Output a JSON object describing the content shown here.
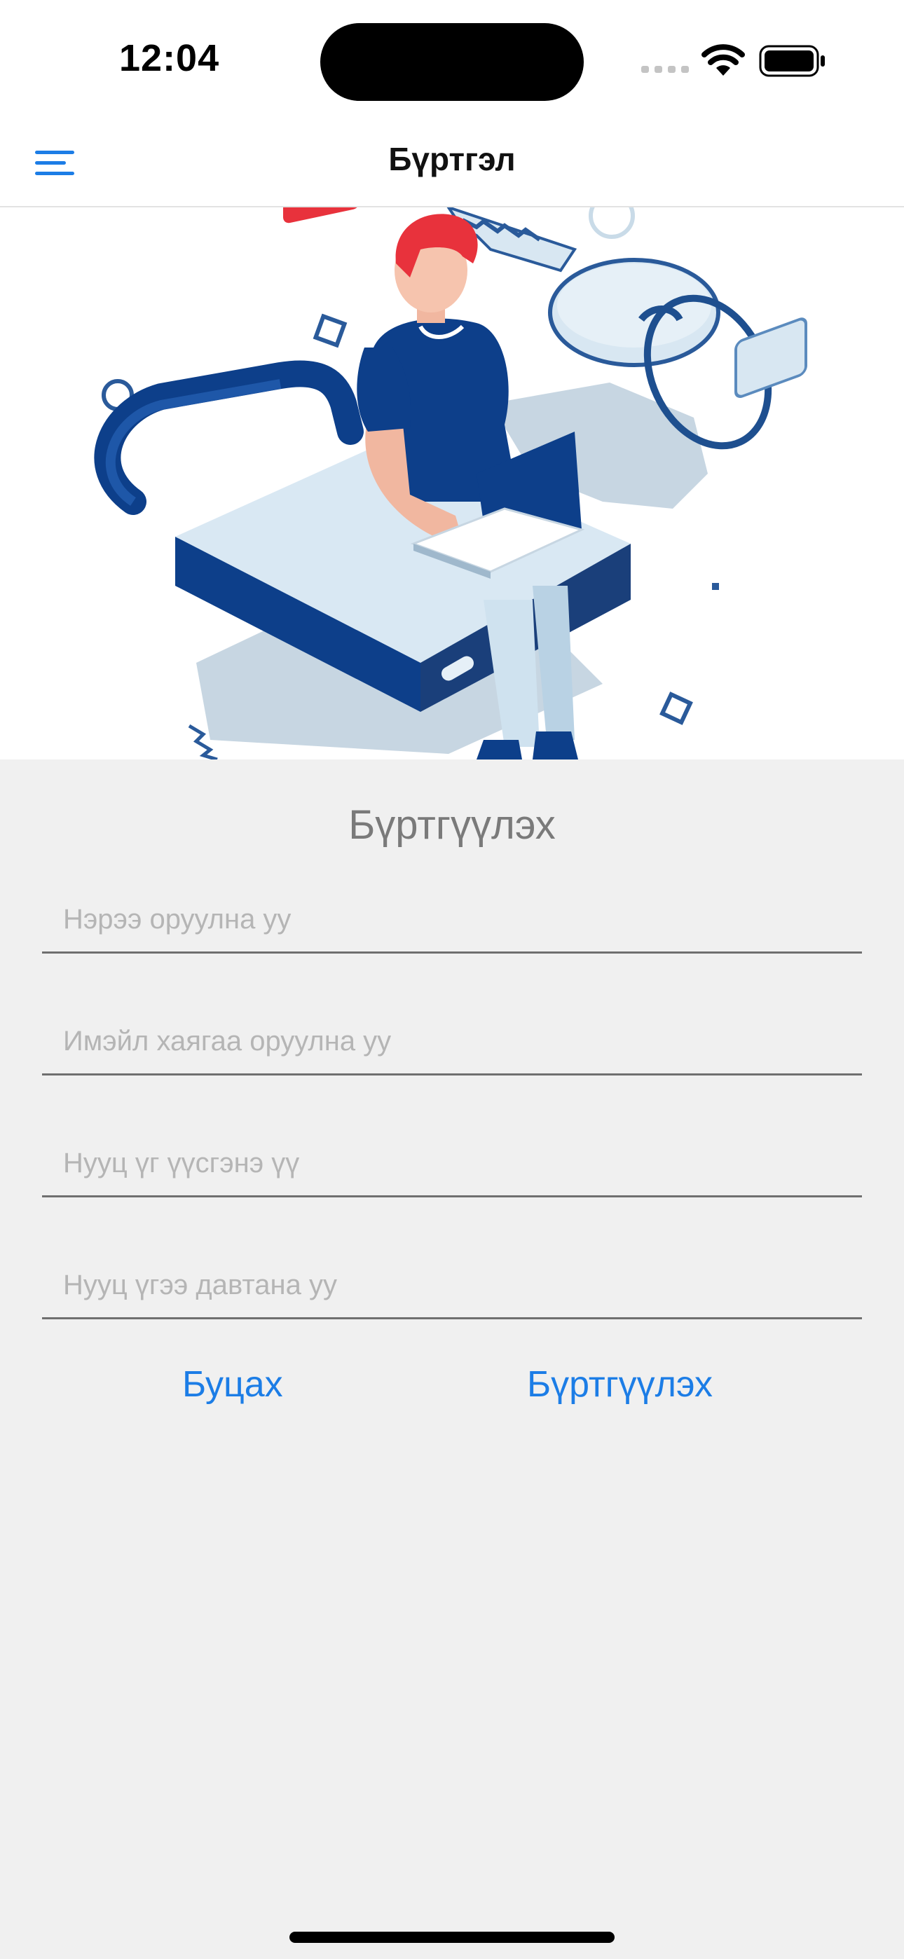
{
  "status_bar": {
    "time": "12:04"
  },
  "nav": {
    "title": "Бүртгэл",
    "menu_icon": "hamburger-menu-icon"
  },
  "hero": {
    "illustration": "person-laptop-padlock-key-illustration"
  },
  "form": {
    "title": "Бүртгүүлэх",
    "name_placeholder": "Нэрээ оруулна уу",
    "email_placeholder": "Имэйл хаягаа оруулна уу",
    "password_placeholder": "Нууц үг үүсгэнэ үү",
    "confirm_placeholder": "Нууц үгээ давтана уу",
    "name_value": "",
    "email_value": "",
    "password_value": "",
    "confirm_value": ""
  },
  "actions": {
    "back_label": "Буцах",
    "register_label": "Бүртгүүлэх"
  },
  "colors": {
    "accent": "#1c7de6",
    "background": "#f0f0f0",
    "header": "#ffffff",
    "illustration_navy": "#0d3f8a",
    "illustration_light": "#cfe2ef",
    "illustration_red": "#e8323c"
  }
}
